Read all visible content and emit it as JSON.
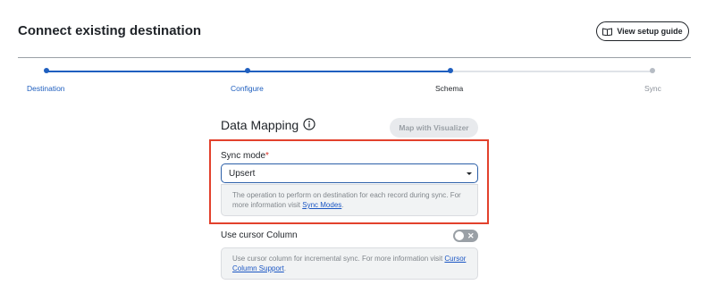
{
  "header": {
    "title": "Connect existing destination",
    "guide_button_label": "View setup guide",
    "guide_button_icon": "book-icon"
  },
  "stepper": {
    "steps": [
      {
        "label": "Destination",
        "state": "complete"
      },
      {
        "label": "Configure",
        "state": "complete"
      },
      {
        "label": "Schema",
        "state": "current"
      },
      {
        "label": "Sync",
        "state": "upcoming"
      }
    ],
    "colors": {
      "active": "#1f5fbf",
      "inactive": "#dfe3e8",
      "inactive_dot": "#b6bcc4",
      "current_label": "#1f2328",
      "muted_label": "#8a9099"
    }
  },
  "mapping": {
    "title": "Data Mapping",
    "info_icon": "info-circle-icon",
    "visualizer_button_label": "Map with Visualizer"
  },
  "sync_mode": {
    "label": "Sync mode",
    "required_marker": "*",
    "selected_value": "Upsert",
    "help_text": "The operation to perform on destination for each record during sync. For more information visit ",
    "help_link": "Sync Modes",
    "help_suffix": "."
  },
  "cursor_column": {
    "label": "Use cursor Column",
    "toggle_on": false,
    "toggle_icon": "x-icon",
    "help_text": "Use cursor column for incremental sync. For more information visit ",
    "help_link": "Cursor Column Support",
    "help_suffix": "."
  },
  "colors": {
    "highlight_border": "#e2412c",
    "link": "#1a56c4"
  }
}
